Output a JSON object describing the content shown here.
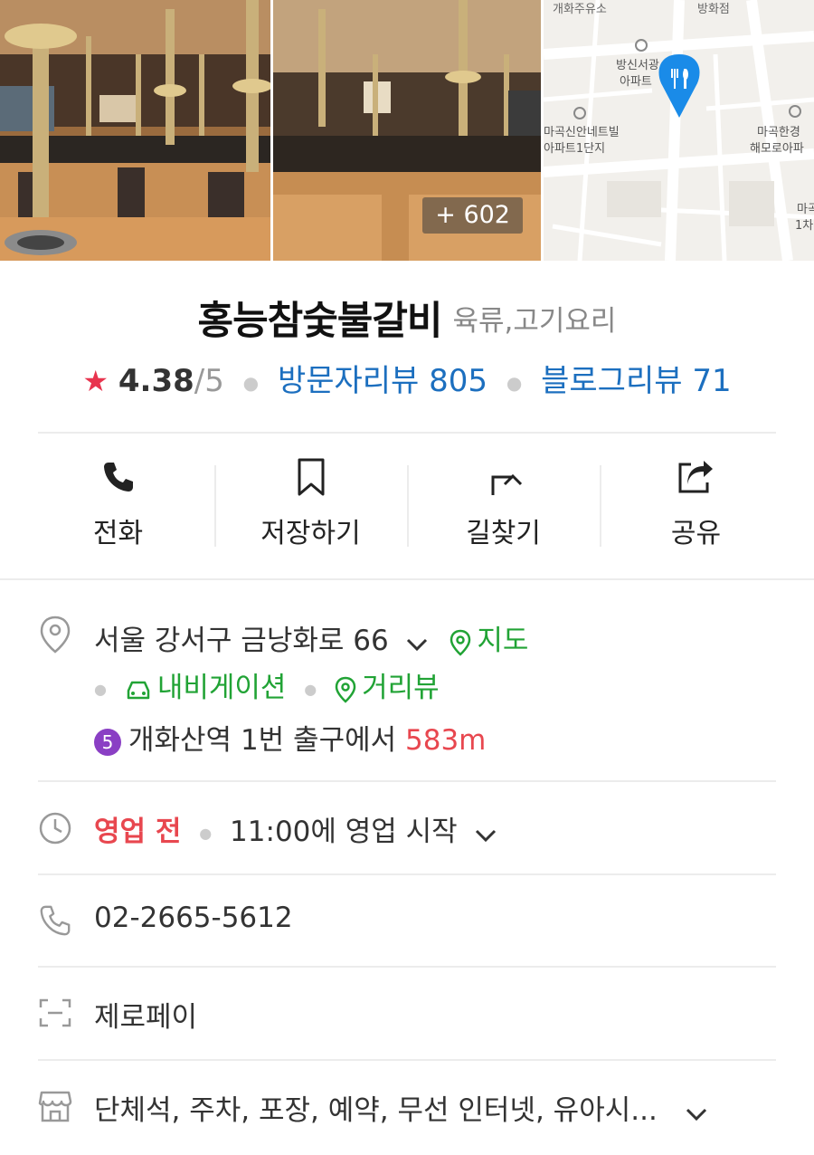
{
  "photos": {
    "more_count": "+ 602",
    "map_labels": {
      "gas_station": "개화주유소",
      "banghwa_jeom": "방화점",
      "apt_banghwa_1": "방신서광",
      "apt_banghwa_2": "아파트",
      "apt_magok_1": "마곡신안네트빌",
      "apt_magok_2": "아파트1단지",
      "apt_right_1": "마곡한경",
      "apt_right_2": "해모로아파",
      "apt_edge_1": "마곡",
      "apt_edge_2": "1차"
    }
  },
  "place": {
    "name": "홍능참숯불갈비",
    "category": "육류,고기요리"
  },
  "rating": {
    "star": "★",
    "score": "4.38",
    "max": "/5",
    "visitor_reviews": "방문자리뷰 805",
    "blog_reviews": "블로그리뷰 71"
  },
  "actions": {
    "call": "전화",
    "save": "저장하기",
    "directions": "길찾기",
    "share": "공유"
  },
  "address": {
    "text": "서울 강서구 금낭화로 66",
    "map_link": "지도",
    "navigation_link": "내비게이션",
    "street_view_link": "거리뷰",
    "subway_line": "5",
    "station": "개화산역",
    "exit_text": "1번 출구에서",
    "distance": "583m"
  },
  "hours": {
    "status": "영업 전",
    "detail": "11:00에 영업 시작"
  },
  "phone": "02-2665-5612",
  "zeropay": "제로페이",
  "amenities": "단체석, 주차, 포장, 예약, 무선 인터넷, 유아시...",
  "colors": {
    "rating_star": "#e8344e",
    "link_blue": "#1c6fbf",
    "link_green": "#21a335",
    "status_red": "#e8474f",
    "map_pin": "#1a8be8",
    "subway_line_5": "#8a3fc4"
  },
  "icons": {
    "call": "phone-icon",
    "save": "bookmark-icon",
    "directions": "turn-arrow-icon",
    "share": "share-icon",
    "address": "location-pin-icon",
    "hours": "clock-icon",
    "phone": "phone-outline-icon",
    "zeropay": "scan-icon",
    "amenities": "store-icon"
  }
}
